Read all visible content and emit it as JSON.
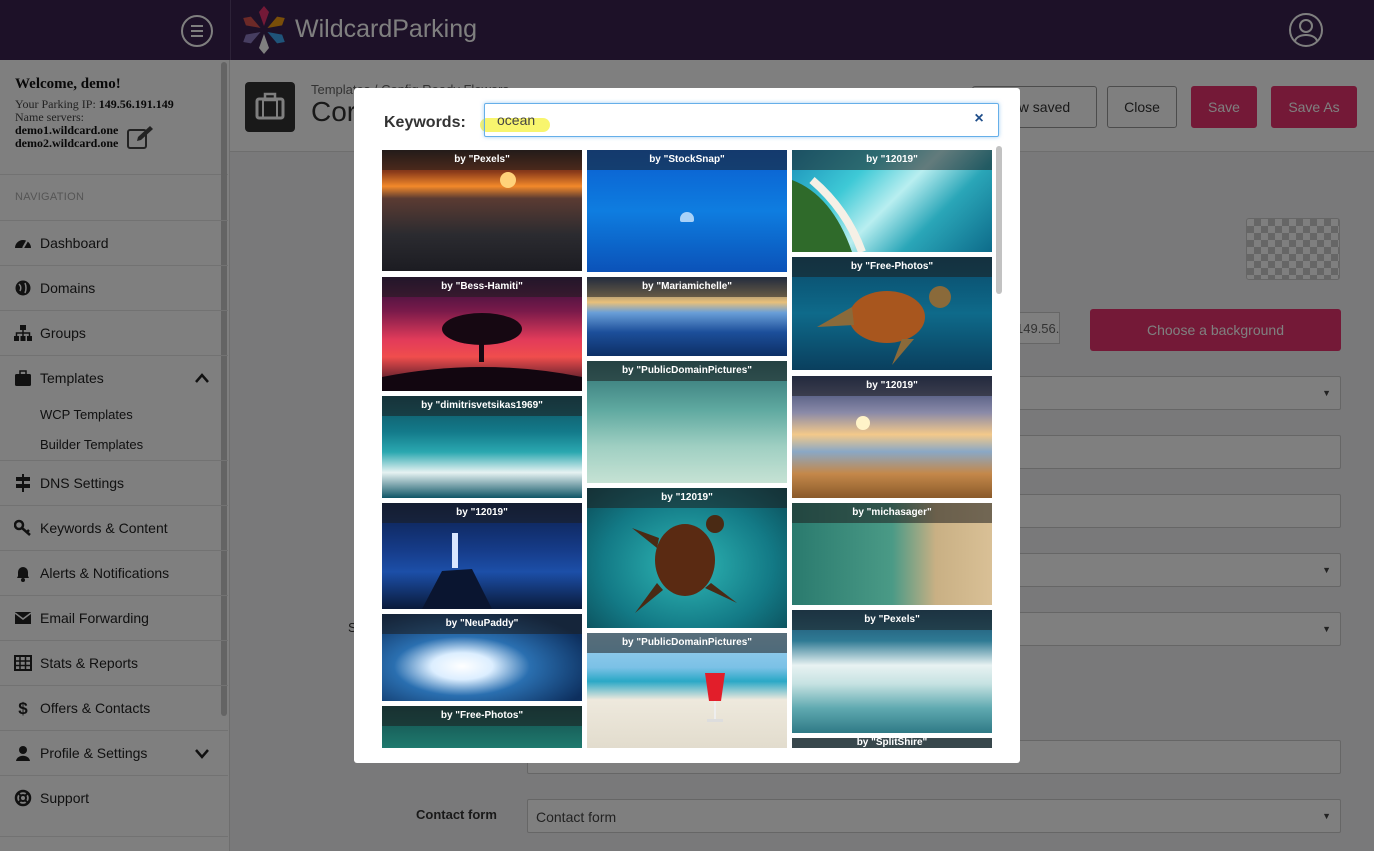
{
  "app": {
    "brand_name": "WildcardParking"
  },
  "sidebar": {
    "welcome": "Welcome, demo!",
    "ip_label": "Your Parking IP:",
    "ip_value": "149.56.191.149",
    "ns_label": "Name servers:",
    "ns1": "demo1.wildcard.one",
    "ns2": "demo2.wildcard.one",
    "nav_heading": "NAVIGATION",
    "items": [
      {
        "label": "Dashboard",
        "icon": "dashboard-icon"
      },
      {
        "label": "Domains",
        "icon": "globe-icon"
      },
      {
        "label": "Groups",
        "icon": "sitemap-icon"
      },
      {
        "label": "Templates",
        "icon": "briefcase-icon"
      },
      {
        "label": "DNS Settings",
        "icon": "signpost-icon"
      },
      {
        "label": "Keywords & Content",
        "icon": "key-icon"
      },
      {
        "label": "Alerts & Notifications",
        "icon": "bell-icon"
      },
      {
        "label": "Email Forwarding",
        "icon": "envelope-icon"
      },
      {
        "label": "Stats & Reports",
        "icon": "table-icon"
      },
      {
        "label": "Offers & Contacts",
        "icon": "dollar-icon"
      },
      {
        "label": "Profile & Settings",
        "icon": "user-icon"
      },
      {
        "label": "Support",
        "icon": "lifebuoy-icon"
      }
    ],
    "sub_items": [
      "WCP Templates",
      "Builder Templates"
    ]
  },
  "header": {
    "breadcrumb": "Templates / Config Ready Flowers",
    "title": "Cor",
    "buttons": {
      "view_saved": "View saved",
      "close": "Close",
      "save": "Save",
      "save_as": "Save As"
    }
  },
  "form": {
    "ip_value": "149.56.191.149",
    "choose_background": "Choose a background",
    "contact_form_label": "Contact form",
    "contact_form_value": "Contact form",
    "partial_label": "S"
  },
  "modal": {
    "keywords_label": "Keywords:",
    "keywords_value": "ocean",
    "clear_symbol": "×",
    "columns": [
      [
        {
          "credit": "by \"Pexels\"",
          "scene": "sunset-waves"
        },
        {
          "credit": "by \"Bess-Hamiti\"",
          "scene": "tree-sunset"
        },
        {
          "credit": "by \"dimitrisvetsikas1969\"",
          "scene": "teal-waves"
        },
        {
          "credit": "by \"12019\"",
          "scene": "lighthouse"
        },
        {
          "credit": "by \"NeuPaddy\"",
          "scene": "big-wave"
        },
        {
          "credit": "by \"Free-Photos\"",
          "scene": "green-water"
        }
      ],
      [
        {
          "credit": "by \"StockSnap\"",
          "scene": "jellyfish"
        },
        {
          "credit": "by \"Mariamichelle\"",
          "scene": "stormy-sea"
        },
        {
          "credit": "by \"PublicDomainPictures\"",
          "scene": "clear-shallows"
        },
        {
          "credit": "by \"12019\"",
          "scene": "sea-turtle"
        },
        {
          "credit": "by \"PublicDomainPictures\"",
          "scene": "beach-drink"
        }
      ],
      [
        {
          "credit": "by \"12019\"",
          "scene": "island-aerial"
        },
        {
          "credit": "by \"Free-Photos\"",
          "scene": "turtle-swimming"
        },
        {
          "credit": "by \"12019\"",
          "scene": "beach-sunset"
        },
        {
          "credit": "by \"michasager\"",
          "scene": "aerial-shore"
        },
        {
          "credit": "by \"Pexels\"",
          "scene": "surf-foam"
        },
        {
          "credit": "by \"SplitShire\"",
          "scene": "partial"
        }
      ]
    ]
  }
}
